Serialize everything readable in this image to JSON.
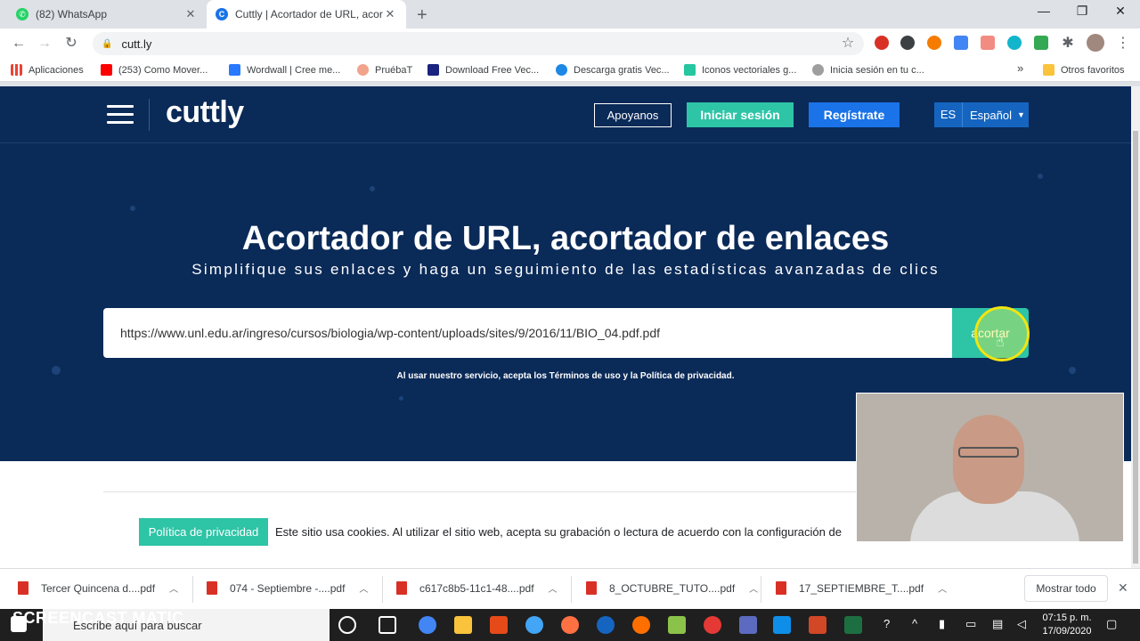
{
  "browser": {
    "tabs": [
      {
        "title": "(82) WhatsApp",
        "active": false
      },
      {
        "title": "Cuttly | Acortador de URL, acorta",
        "active": true
      }
    ],
    "address": "cutt.ly",
    "bookmarks": [
      "Aplicaciones",
      "(253) Como Mover...",
      "Wordwall | Cree me...",
      "PruébaT",
      "Download Free Vec...",
      "Descarga gratis Vec...",
      "Iconos vectoriales g...",
      "Inicia sesión en tu c..."
    ],
    "other_bookmarks": "Otros favoritos",
    "overflow": "»"
  },
  "site": {
    "logo": "cuttly",
    "nav": {
      "support": "Apoyanos",
      "login": "Iniciar sesión",
      "register": "Regístrate",
      "lang_code": "ES",
      "lang_name": "Español"
    },
    "hero": {
      "title": "Acortador de URL, acortador de enlaces",
      "subtitle": "Simplifique sus enlaces y haga un seguimiento de las estadísticas avanzadas de clics"
    },
    "url_value": "https://www.unl.edu.ar/ingreso/cursos/biologia/wp-content/uploads/sites/9/2016/11/BIO_04.pdf.pdf",
    "shorten_label": "acortar",
    "terms": "Al usar nuestro servicio, acepta los Términos de uso y la Política de privacidad.",
    "cookie": {
      "button": "Política de privacidad",
      "text": "Este sitio usa cookies. Al utilizar el sitio web, acepta su grabación o lectura de acuerdo con la configuración de"
    }
  },
  "downloads": {
    "items": [
      "Tercer Quincena d....pdf",
      "074 - Septiembre -....pdf",
      "c617c8b5-11c1-48....pdf",
      "8_OCTUBRE_TUTO....pdf",
      "17_SEPTIEMBRE_T....pdf"
    ],
    "show_all": "Mostrar todo"
  },
  "taskbar": {
    "search_placeholder": "Escribe aquí para buscar",
    "time": "07:15 p. m.",
    "date": "17/09/2020"
  },
  "watermark": {
    "recorded": "RECORDED WITH",
    "brand": "SCREENCAST  MATIC"
  }
}
